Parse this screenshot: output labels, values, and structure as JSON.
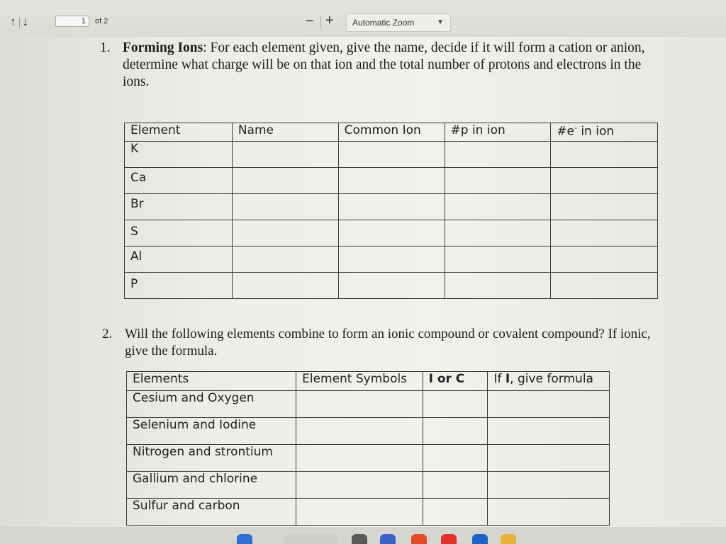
{
  "toolbar": {
    "up_icon": "up-arrow-icon",
    "down_icon": "down-arrow-icon",
    "page_number": "1",
    "page_count": "of 2",
    "zoom_out": "−",
    "zoom_in": "+",
    "zoom_value": "Automatic Zoom"
  },
  "q1": {
    "number": "1.",
    "title": "Forming Ions",
    "text": ": For each element given, give the name, decide if it will form a cation or anion, determine what charge will be on that ion and the total number of protons and electrons in the ions."
  },
  "table1": {
    "headers": [
      "Element",
      "Name",
      "Common Ion",
      "#p in ion",
      "#e in ion"
    ],
    "header_e_prefix": "#e",
    "header_e_suffix": " in ion",
    "header_e_superscript": "-",
    "rows": [
      "K",
      "Ca",
      "Br",
      "S",
      "Al",
      "P"
    ]
  },
  "q2": {
    "number": "2.",
    "text": "Will the following elements combine to form an ionic compound or covalent compound? If ionic, give the formula."
  },
  "table2": {
    "headers": [
      "Elements",
      "Element Symbols",
      "I or C",
      "If I, give formula"
    ],
    "header_formula_prefix": "If ",
    "header_formula_bold": "I",
    "header_formula_suffix": ", give formula",
    "rows": [
      "Cesium and Oxygen",
      "Selenium and Iodine",
      "Nitrogen and strontium",
      "Gallium and chlorine",
      "Sulfur and carbon"
    ]
  },
  "colors": {
    "toolbar_bg": "#dcdbd6",
    "page_bg": "#f2f1ed",
    "grid_line": "#3a3a3a"
  }
}
